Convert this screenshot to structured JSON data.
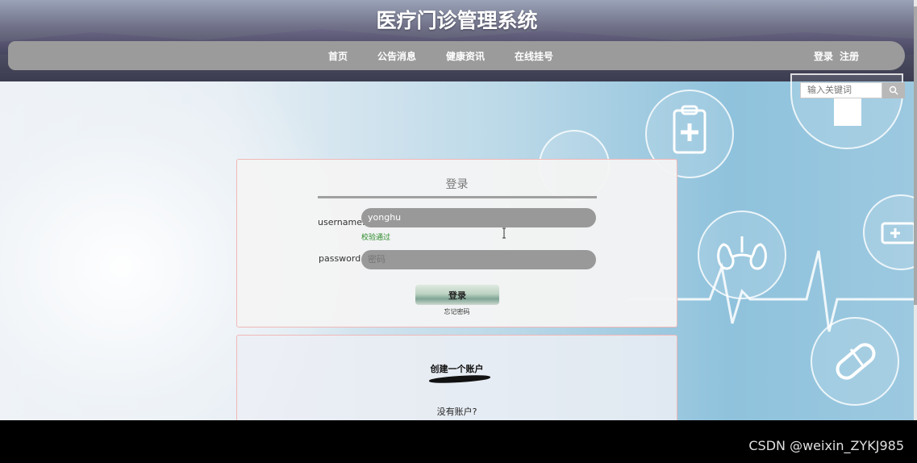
{
  "site": {
    "title": "医疗门诊管理系统"
  },
  "nav": {
    "items": [
      {
        "label": "首页"
      },
      {
        "label": "公告消息"
      },
      {
        "label": "健康资讯"
      },
      {
        "label": "在线挂号"
      }
    ],
    "login_label": "登录",
    "register_label": "注册"
  },
  "search": {
    "placeholder": "输入关键词"
  },
  "login": {
    "title": "登录",
    "username_label": "username:",
    "username_value": "yonghu",
    "validation_message": "校验通过",
    "password_label": "password:",
    "password_placeholder": "密码",
    "submit_label": "登录",
    "forgot_label": "忘记密码"
  },
  "register": {
    "title": "创建一个账户",
    "question": "没有账户?"
  },
  "watermark": "CSDN @weixin_ZYKJ985",
  "colors": {
    "nav_bg": "#9b9b9b",
    "input_bg": "#999999",
    "validation": "#2a8a2a",
    "panel_border": "#f0b8b8"
  }
}
